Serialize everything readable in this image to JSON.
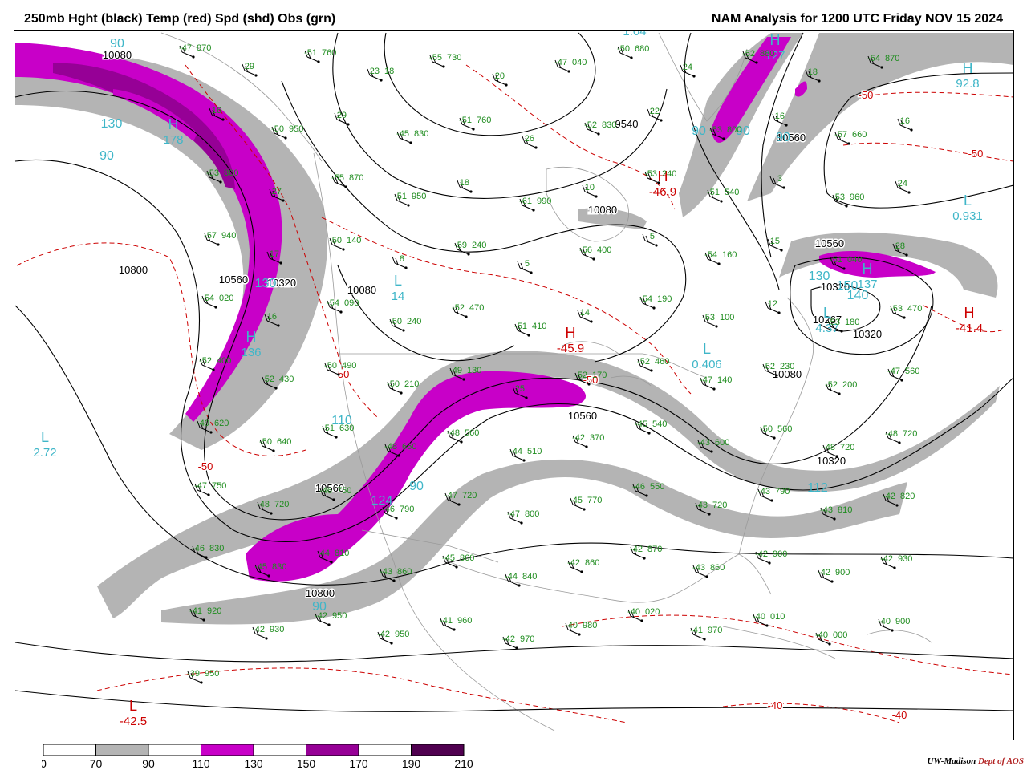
{
  "header": {
    "left_title": "250mb Hght (black) Temp (red) Spd (shd) Obs (grn)",
    "right_title": "NAM Analysis for 1200 UTC Friday  NOV 15 2024"
  },
  "colors": {
    "height_contour": "#000000",
    "temp_contour": "#cc0000",
    "obs_text": "#1e8c1e",
    "speed_label": "#3fb6c8",
    "border": "#9a9a9a",
    "shade_70": "#b4b4b4",
    "shade_110": "#c800c8",
    "shade_150": "#960096",
    "shade_190": "#500050"
  },
  "legend": {
    "ticks": [
      "0",
      "70",
      "90",
      "110",
      "130",
      "150",
      "170",
      "190",
      "210"
    ],
    "fills": [
      "#ffffff",
      "#b4b4b4",
      "#ffffff",
      "#c800c8",
      "#ffffff",
      "#960096",
      "#ffffff",
      "#500050"
    ]
  },
  "height_labels": [
    "10080",
    "10800",
    "10560",
    "10320",
    "10080",
    "9540",
    "10080",
    "10560",
    "10560",
    "10320",
    "10267",
    "10320",
    "10560",
    "10320",
    "10800",
    "10560",
    "10080"
  ],
  "centers": [
    {
      "letter": "H",
      "kind": "high",
      "value": "178"
    },
    {
      "letter": "L",
      "kind": "low",
      "value": "2.72"
    },
    {
      "letter": "H",
      "kind": "high",
      "value": "136"
    },
    {
      "letter": "L",
      "kind": "low",
      "value": "14"
    },
    {
      "letter": "H",
      "kind": "high",
      "value": "127"
    },
    {
      "letter": "H",
      "kind": "high",
      "value": "92.8"
    },
    {
      "letter": "L",
      "kind": "low",
      "value": "0.931"
    },
    {
      "letter": "L",
      "kind": "low",
      "value": "4.37"
    },
    {
      "letter": "L",
      "kind": "low",
      "value": "0.406"
    },
    {
      "letter": "H",
      "kind": "high",
      "value": "137"
    },
    {
      "letter": "H",
      "kind": "high",
      "value": "-41.4"
    },
    {
      "letter": "H",
      "kind": "high",
      "value": "-46.9"
    },
    {
      "letter": "H",
      "kind": "high",
      "value": "-45.9"
    },
    {
      "letter": "L",
      "kind": "low",
      "value": "-42.5"
    },
    {
      "letter": "L",
      "kind": "low",
      "value": "1.04"
    }
  ],
  "speed_labels": [
    "90",
    "130",
    "90",
    "130",
    "110",
    "90",
    "124",
    "90",
    "112",
    "90",
    "90",
    "90",
    "130",
    "150",
    "140"
  ],
  "temp_labels": [
    "-50",
    "-50",
    "-50",
    "-50",
    "-50",
    "-40",
    "-40"
  ],
  "observations": [
    [
      "-47",
      "870"
    ],
    [
      "29",
      ""
    ],
    [
      "-51",
      "760"
    ],
    [
      "23",
      "18"
    ],
    [
      "-55",
      "730"
    ],
    [
      "20",
      ""
    ],
    [
      "-47",
      "040"
    ],
    [
      "-50",
      "680"
    ],
    [
      "24",
      ""
    ],
    [
      "-52",
      "880"
    ],
    [
      "18",
      ""
    ],
    [
      "-54",
      "870"
    ],
    [
      "16",
      ""
    ],
    [
      "-50",
      "950"
    ],
    [
      "29",
      ""
    ],
    [
      "-45",
      "830"
    ],
    [
      "-51",
      "760"
    ],
    [
      "26",
      ""
    ],
    [
      "-52",
      "830"
    ],
    [
      "22",
      ""
    ],
    [
      "-53",
      "800"
    ],
    [
      "16",
      ""
    ],
    [
      "-57",
      "660"
    ],
    [
      "16",
      ""
    ],
    [
      "-53",
      "800"
    ],
    [
      "27",
      ""
    ],
    [
      "-55",
      "870"
    ],
    [
      "-51",
      "950"
    ],
    [
      "18",
      ""
    ],
    [
      "-61",
      "990"
    ],
    [
      "10",
      ""
    ],
    [
      "-53",
      "240"
    ],
    [
      "-51",
      "540"
    ],
    [
      "3",
      ""
    ],
    [
      "-53",
      "960"
    ],
    [
      "24",
      ""
    ],
    [
      "-57",
      "940"
    ],
    [
      "17",
      ""
    ],
    [
      "-50",
      "140"
    ],
    [
      "8",
      ""
    ],
    [
      "-59",
      "240"
    ],
    [
      "5",
      ""
    ],
    [
      "-56",
      "400"
    ],
    [
      "5",
      ""
    ],
    [
      "-54",
      "160"
    ],
    [
      "15",
      ""
    ],
    [
      "-51",
      "040"
    ],
    [
      "28",
      ""
    ],
    [
      "-54",
      "020"
    ],
    [
      "16",
      ""
    ],
    [
      "-54",
      "090"
    ],
    [
      "-50",
      "240"
    ],
    [
      "-52",
      "470"
    ],
    [
      "-51",
      "410"
    ],
    [
      "14",
      ""
    ],
    [
      "-54",
      "190"
    ],
    [
      "-53",
      "100"
    ],
    [
      "12",
      ""
    ],
    [
      "-53",
      "180"
    ],
    [
      "-53",
      "470"
    ],
    [
      "-52",
      "400"
    ],
    [
      "-52",
      "430"
    ],
    [
      "-50",
      "490"
    ],
    [
      "-50",
      "210"
    ],
    [
      "-49",
      "130"
    ],
    [
      "25",
      ""
    ],
    [
      "-52",
      "170"
    ],
    [
      "-52",
      "460"
    ],
    [
      "-47",
      "140"
    ],
    [
      "-52",
      "230"
    ],
    [
      "-52",
      "200"
    ],
    [
      "-47",
      "560"
    ],
    [
      "-49",
      "620"
    ],
    [
      "-50",
      "640"
    ],
    [
      "-51",
      "630"
    ],
    [
      "-48",
      "660"
    ],
    [
      "-48",
      "560"
    ],
    [
      "-44",
      "510"
    ],
    [
      "-42",
      "370"
    ],
    [
      "-45",
      "540"
    ],
    [
      "-43",
      "600"
    ],
    [
      "-50",
      "560"
    ],
    [
      "-48",
      "720"
    ],
    [
      "-48",
      "720"
    ],
    [
      "-47",
      "750"
    ],
    [
      "-48",
      "720"
    ],
    [
      "-46",
      "750"
    ],
    [
      "-46",
      "790"
    ],
    [
      "-47",
      "720"
    ],
    [
      "-47",
      "800"
    ],
    [
      "-45",
      "770"
    ],
    [
      "-46",
      "550"
    ],
    [
      "-43",
      "720"
    ],
    [
      "-43",
      "790"
    ],
    [
      "-43",
      "810"
    ],
    [
      "-42",
      "820"
    ],
    [
      "-46",
      "830"
    ],
    [
      "-45",
      "830"
    ],
    [
      "-44",
      "810"
    ],
    [
      "-43",
      "860"
    ],
    [
      "-45",
      "860"
    ],
    [
      "-44",
      "840"
    ],
    [
      "-42",
      "860"
    ],
    [
      "-42",
      "870"
    ],
    [
      "-43",
      "860"
    ],
    [
      "-42",
      "900"
    ],
    [
      "-42",
      "900"
    ],
    [
      "-42",
      "930"
    ],
    [
      "-41",
      "920"
    ],
    [
      "-42",
      "930"
    ],
    [
      "-42",
      "950"
    ],
    [
      "-42",
      "950"
    ],
    [
      "-41",
      "960"
    ],
    [
      "-42",
      "970"
    ],
    [
      "-40",
      "980"
    ],
    [
      "-40",
      "020"
    ],
    [
      "-41",
      "970"
    ],
    [
      "-40",
      "010"
    ],
    [
      "-40",
      "000"
    ],
    [
      "-40",
      "900"
    ],
    [
      "-39",
      "950"
    ]
  ],
  "credit": {
    "org": "UW-Madison",
    "dept": "Dept of AOS"
  }
}
